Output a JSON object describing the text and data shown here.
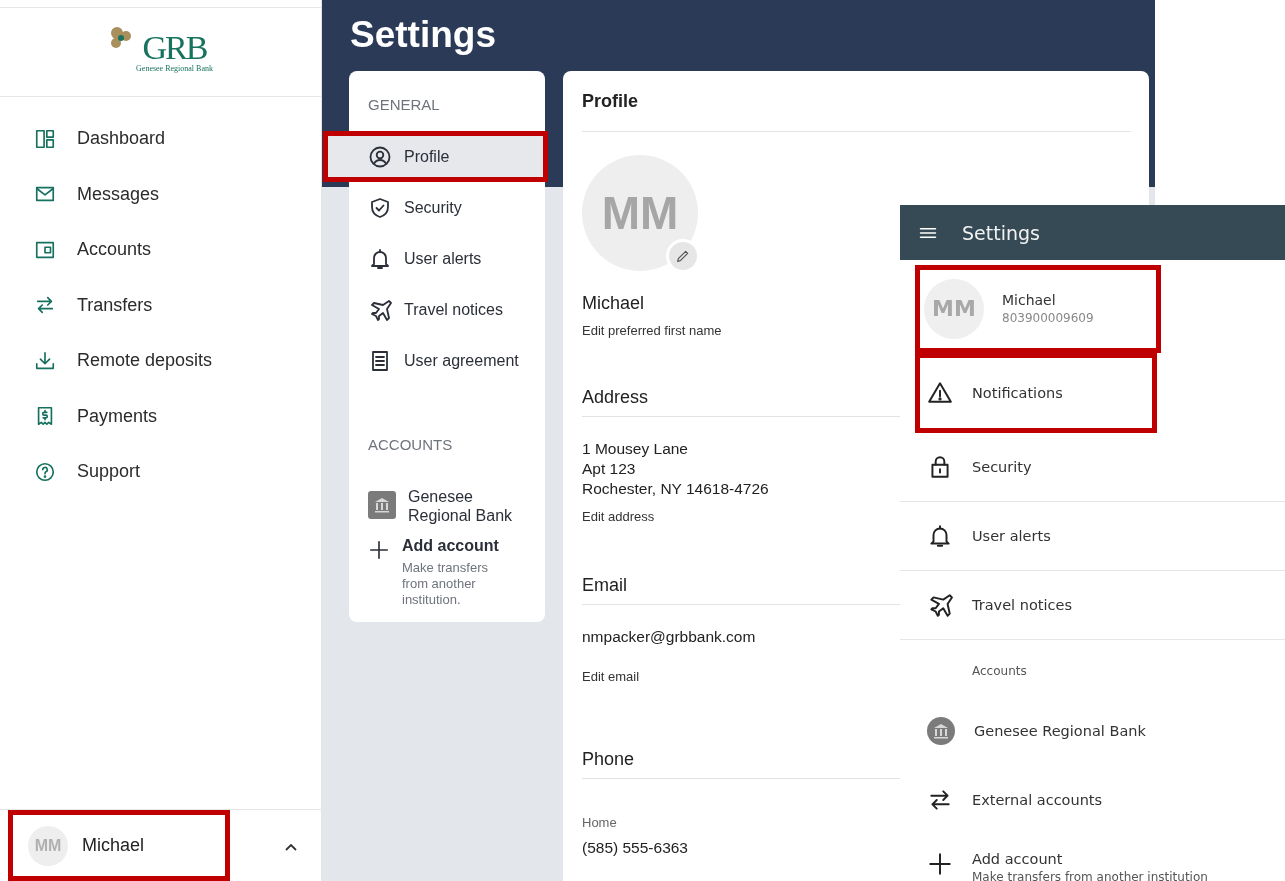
{
  "sidebar": {
    "logo": {
      "mark": "GRB",
      "name": "Genesee Regional Bank"
    },
    "nav": [
      {
        "label": "Dashboard"
      },
      {
        "label": "Messages"
      },
      {
        "label": "Accounts"
      },
      {
        "label": "Transfers"
      },
      {
        "label": "Remote deposits"
      },
      {
        "label": "Payments"
      },
      {
        "label": "Support"
      }
    ],
    "user": {
      "initials": "MM",
      "name": "Michael",
      "highlighted": true
    }
  },
  "page": {
    "title": "Settings"
  },
  "settings_nav": {
    "sections": [
      {
        "heading": "GENERAL",
        "items": [
          {
            "kind": "link",
            "label": "Profile",
            "selected": true,
            "highlighted": true
          },
          {
            "kind": "link",
            "label": "Security",
            "selected": false,
            "highlighted": false
          },
          {
            "kind": "link",
            "label": "User alerts",
            "selected": false,
            "highlighted": false
          },
          {
            "kind": "link",
            "label": "Travel notices",
            "selected": false,
            "highlighted": false
          },
          {
            "kind": "link",
            "label": "User agreement",
            "selected": false,
            "highlighted": false
          }
        ]
      },
      {
        "heading": "ACCOUNTS",
        "items": [
          {
            "kind": "account",
            "label": "Genesee Regional Bank",
            "selected": false,
            "highlighted": false
          },
          {
            "kind": "add",
            "label": "Add account",
            "description": "Make transfers from another institution.",
            "selected": false,
            "highlighted": false
          }
        ]
      }
    ]
  },
  "profile": {
    "title": "Profile",
    "initials": "MM",
    "name": "Michael",
    "name_link": "Edit preferred first name",
    "sections": [
      {
        "heading": "Address",
        "lines": [
          "1 Mousey Lane",
          "Apt 123",
          "Rochester, NY 14618-4726"
        ],
        "link": "Edit address"
      },
      {
        "heading": "Email",
        "lines": [
          "nmpacker@grbbank.com"
        ],
        "link": "Edit email"
      },
      {
        "heading": "Phone",
        "label": "Home",
        "lines": [
          "(585) 555-6363"
        ]
      }
    ]
  },
  "mobile": {
    "title": "Settings",
    "user": {
      "initials": "MM",
      "name": "Michael",
      "account_number": "803900009609",
      "highlighted": true
    },
    "items": [
      {
        "kind": "link",
        "label": "Notifications",
        "highlighted": true
      },
      {
        "kind": "link",
        "label": "Security",
        "highlighted": false
      },
      {
        "kind": "link",
        "label": "User alerts",
        "highlighted": false
      },
      {
        "kind": "link",
        "label": "Travel notices",
        "highlighted": false
      },
      {
        "kind": "heading",
        "label": "Accounts",
        "highlighted": false
      },
      {
        "kind": "account",
        "label": "Genesee Regional Bank",
        "highlighted": false
      },
      {
        "kind": "plain",
        "label": "External accounts",
        "highlighted": false
      },
      {
        "kind": "add",
        "label": "Add account",
        "description": "Make transfers from another institution",
        "highlighted": false
      }
    ]
  }
}
